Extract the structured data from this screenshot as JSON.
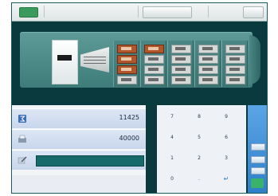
{
  "header": {
    "status_badge": "",
    "title_text": "",
    "center_button": "",
    "info_text": "",
    "right_button": ""
  },
  "entry": {
    "rows": [
      {
        "icon": "sum-icon",
        "value": "11425"
      },
      {
        "icon": "printer-icon",
        "value": "40000"
      },
      {
        "icon": "edit-icon",
        "value": ""
      }
    ]
  },
  "keypad": {
    "keys": [
      "7",
      "8",
      "9",
      "4",
      "5",
      "6",
      "1",
      "2",
      "3",
      "0",
      ".",
      "↵"
    ]
  },
  "side": {
    "label_top": "",
    "buttons": [
      "",
      "",
      ""
    ],
    "confirm": ""
  },
  "colors": {
    "screen_bg": "#0a3a3e",
    "machine": "#4f8a88",
    "active_cell": "#b0562a",
    "input_fill": "#176a6a",
    "side_panel": "#3f90d8"
  }
}
